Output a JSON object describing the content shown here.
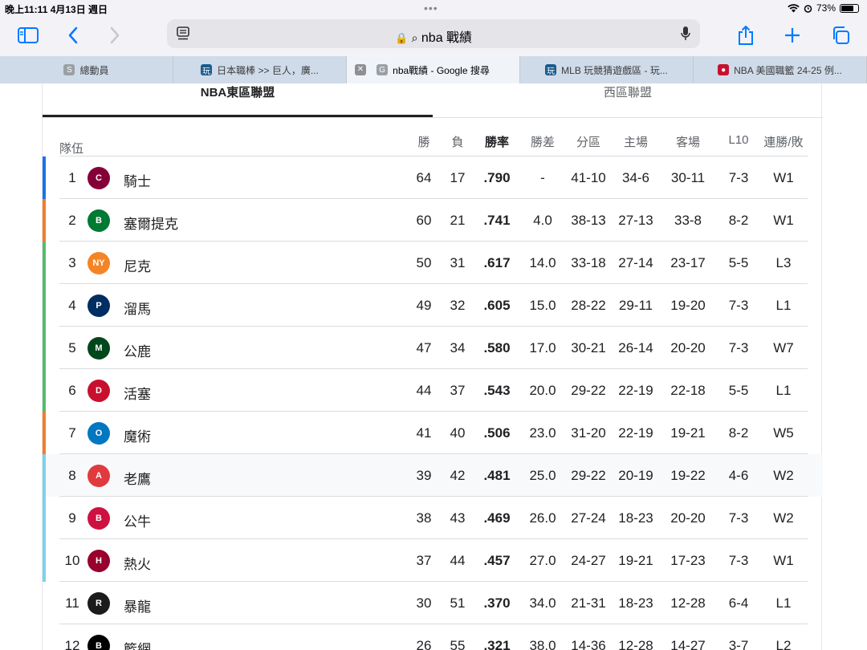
{
  "status": {
    "time": "晚上11:11   4月13日 週日",
    "battery": "73%",
    "battery_level": 0.73
  },
  "browser": {
    "url": "nba 戰績",
    "tabs": [
      {
        "label": "總動員",
        "fav": "S",
        "color": "#9aa0a6",
        "active": false
      },
      {
        "label": "日本職棒 >> 巨人，廣...",
        "fav": "玩",
        "color": "#1a5c8e",
        "active": false
      },
      {
        "label": "nba戰績 - Google 搜尋",
        "fav": "G",
        "color": "#9aa0a6",
        "active": true
      },
      {
        "label": "MLB 玩競猜遊戲區 - 玩...",
        "fav": "玩",
        "color": "#1a5c8e",
        "active": false
      },
      {
        "label": "NBA 美國職籃 24-25 例...",
        "fav": "●",
        "color": "#c8102e",
        "active": false
      }
    ]
  },
  "conference_tabs": {
    "east": "NBA東區聯盟",
    "west": "西區聯盟"
  },
  "headers": {
    "team": "隊伍",
    "w": "勝",
    "l": "負",
    "pct": "勝率",
    "gb": "勝差",
    "div": "分區",
    "home": "主場",
    "away": "客場",
    "l10": "L10",
    "strk": "連勝/敗"
  },
  "teams": [
    {
      "rank": "1",
      "name": "騎士",
      "logo": "C",
      "logo_color": "#860038",
      "bar": "#1a73e8",
      "w": "64",
      "l": "17",
      "pct": ".790",
      "gb": "-",
      "div": "41-10",
      "home": "34-6",
      "away": "30-11",
      "l10": "7-3",
      "strk": "W1"
    },
    {
      "rank": "2",
      "name": "塞爾提克",
      "logo": "B",
      "logo_color": "#007a33",
      "bar": "#f57c29",
      "w": "60",
      "l": "21",
      "pct": ".741",
      "gb": "4.0",
      "div": "38-13",
      "home": "27-13",
      "away": "33-8",
      "l10": "8-2",
      "strk": "W1"
    },
    {
      "rank": "3",
      "name": "尼克",
      "logo": "NY",
      "logo_color": "#f58426",
      "bar": "#57bb6f",
      "w": "50",
      "l": "31",
      "pct": ".617",
      "gb": "14.0",
      "div": "33-18",
      "home": "27-14",
      "away": "23-17",
      "l10": "5-5",
      "strk": "L3"
    },
    {
      "rank": "4",
      "name": "溜馬",
      "logo": "P",
      "logo_color": "#002d62",
      "bar": "#57bb6f",
      "w": "49",
      "l": "32",
      "pct": ".605",
      "gb": "15.0",
      "div": "28-22",
      "home": "29-11",
      "away": "19-20",
      "l10": "7-3",
      "strk": "L1"
    },
    {
      "rank": "5",
      "name": "公鹿",
      "logo": "M",
      "logo_color": "#00471b",
      "bar": "#57bb6f",
      "w": "47",
      "l": "34",
      "pct": ".580",
      "gb": "17.0",
      "div": "30-21",
      "home": "26-14",
      "away": "20-20",
      "l10": "7-3",
      "strk": "W7"
    },
    {
      "rank": "6",
      "name": "活塞",
      "logo": "D",
      "logo_color": "#c8102e",
      "bar": "#57bb6f",
      "w": "44",
      "l": "37",
      "pct": ".543",
      "gb": "20.0",
      "div": "29-22",
      "home": "22-19",
      "away": "22-18",
      "l10": "5-5",
      "strk": "L1"
    },
    {
      "rank": "7",
      "name": "魔術",
      "logo": "O",
      "logo_color": "#0077c0",
      "bar": "#f57c29",
      "w": "41",
      "l": "40",
      "pct": ".506",
      "gb": "23.0",
      "div": "31-20",
      "home": "22-19",
      "away": "19-21",
      "l10": "8-2",
      "strk": "W5"
    },
    {
      "rank": "8",
      "name": "老鷹",
      "logo": "A",
      "logo_color": "#e03a3e",
      "bar": "#7fd0f0",
      "w": "39",
      "l": "42",
      "pct": ".481",
      "gb": "25.0",
      "div": "29-22",
      "home": "20-19",
      "away": "19-22",
      "l10": "4-6",
      "strk": "W2"
    },
    {
      "rank": "9",
      "name": "公牛",
      "logo": "B",
      "logo_color": "#ce1141",
      "bar": "#7fd0f0",
      "w": "38",
      "l": "43",
      "pct": ".469",
      "gb": "26.0",
      "div": "27-24",
      "home": "18-23",
      "away": "20-20",
      "l10": "7-3",
      "strk": "W2"
    },
    {
      "rank": "10",
      "name": "熱火",
      "logo": "H",
      "logo_color": "#98002e",
      "bar": "#7fd0f0",
      "w": "37",
      "l": "44",
      "pct": ".457",
      "gb": "27.0",
      "div": "24-27",
      "home": "19-21",
      "away": "17-23",
      "l10": "7-3",
      "strk": "W1"
    },
    {
      "rank": "11",
      "name": "暴龍",
      "logo": "R",
      "logo_color": "#1b1b1b",
      "bar": "",
      "w": "30",
      "l": "51",
      "pct": ".370",
      "gb": "34.0",
      "div": "21-31",
      "home": "18-23",
      "away": "12-28",
      "l10": "6-4",
      "strk": "L1"
    },
    {
      "rank": "12",
      "name": "籃網",
      "logo": "B",
      "logo_color": "#000000",
      "bar": "",
      "w": "26",
      "l": "55",
      "pct": ".321",
      "gb": "38.0",
      "div": "14-36",
      "home": "12-28",
      "away": "14-27",
      "l10": "3-7",
      "strk": "L2"
    }
  ]
}
